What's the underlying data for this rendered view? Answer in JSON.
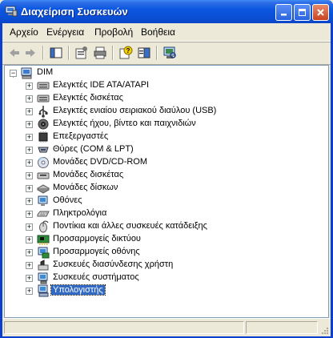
{
  "window": {
    "title": "Διαχείριση Συσκευών"
  },
  "menu": [
    "Αρχείο",
    "Ενέργεια",
    "Προβολή",
    "Βοήθεια"
  ],
  "toolbar": {
    "buttons": [
      "back-icon",
      "forward-icon",
      "show-hide-tree-icon",
      "properties-icon",
      "print-icon",
      "help-icon",
      "help-topics-icon",
      "scan-hardware-icon"
    ]
  },
  "tree": {
    "root": "DIM",
    "items": [
      {
        "label": "Ελεγκτές IDE ATA/ATAPI",
        "icon": "ide-controller-icon"
      },
      {
        "label": "Ελεγκτές δισκέτας",
        "icon": "floppy-controller-icon"
      },
      {
        "label": "Ελεγκτές ενιαίου σειριακού διαύλου (USB)",
        "icon": "usb-icon"
      },
      {
        "label": "Ελεγκτές ήχου, βίντεο και παιχνιδιών",
        "icon": "sound-icon"
      },
      {
        "label": "Επεξεργαστές",
        "icon": "processor-icon"
      },
      {
        "label": "Θύρες (COM & LPT)",
        "icon": "port-icon"
      },
      {
        "label": "Μονάδες DVD/CD-ROM",
        "icon": "dvd-drive-icon"
      },
      {
        "label": "Μονάδες δισκέτας",
        "icon": "floppy-drive-icon"
      },
      {
        "label": "Μονάδες δίσκων",
        "icon": "disk-drive-icon"
      },
      {
        "label": "Οθόνες",
        "icon": "monitor-icon"
      },
      {
        "label": "Πληκτρολόγια",
        "icon": "keyboard-icon"
      },
      {
        "label": "Ποντίκια και άλλες συσκευές κατάδειξης",
        "icon": "mouse-icon"
      },
      {
        "label": "Προσαρμογείς δικτύου",
        "icon": "network-adapter-icon"
      },
      {
        "label": "Προσαρμογείς οθόνης",
        "icon": "display-adapter-icon"
      },
      {
        "label": "Συσκευές διασύνδεσης χρήστη",
        "icon": "hid-icon"
      },
      {
        "label": "Συσκευές συστήματος",
        "icon": "system-device-icon"
      },
      {
        "label": "Υπολογιστής",
        "icon": "computer-icon",
        "selected": true
      }
    ]
  },
  "colors": {
    "titlebar": "#0A4FD6",
    "selection": "#316AC5",
    "tree_border": "#7F9DB9"
  }
}
